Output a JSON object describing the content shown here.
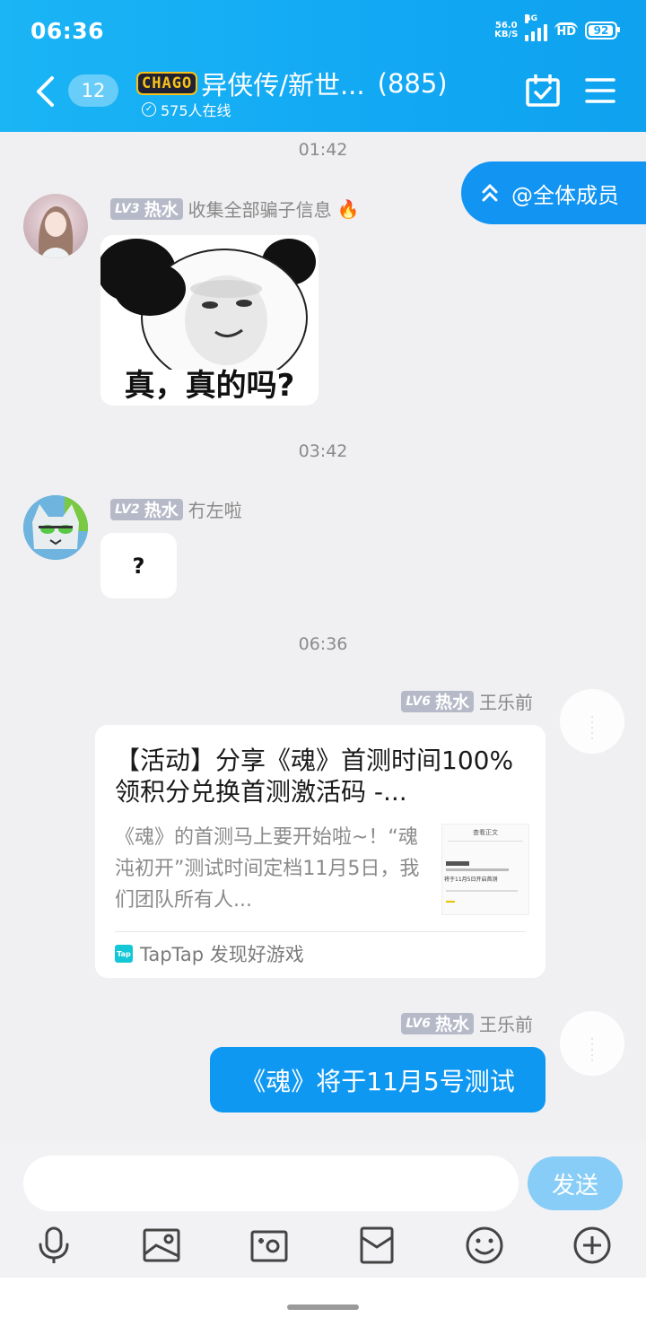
{
  "status_bar": {
    "time": "06:36",
    "net_speed_value": "56.0",
    "net_speed_unit": "KB/S",
    "network": "4G",
    "hd": "HD",
    "battery": "92"
  },
  "header": {
    "unread_count": "12",
    "logo_text": "CHAGO",
    "title": "异侠传/新世...",
    "member_count": "(885)",
    "online": "575人在线",
    "accent_color": "#12a8f3"
  },
  "at_all": {
    "label": "@全体成员"
  },
  "messages": [
    {
      "timestamp": "01:42",
      "level": "LV3",
      "tag": "热水",
      "sender": "收集全部骗子信息",
      "sender_emoji": "🔥",
      "sticker_caption": "真，真的吗?"
    },
    {
      "timestamp": "03:42",
      "level": "LV2",
      "tag": "热水",
      "sender": "冇左啦",
      "text": "?"
    },
    {
      "timestamp": "06:36",
      "level": "LV6",
      "tag": "热水",
      "sender": "王乐前",
      "card": {
        "title": "【活动】分享《魂》首测时间100%领积分兑换首测激活码 -...",
        "description": "《魂》的首测马上要开始啦~！“魂沌初开”测试时间定档11月5日，我们团队所有人...",
        "thumb_header": "查看正文",
        "thumb_line": "将于11月5日开启首测",
        "source_icon": "Tap",
        "source": "TapTap 发现好游戏"
      }
    },
    {
      "level": "LV6",
      "tag": "热水",
      "sender": "王乐前",
      "text": "《魂》将于11月5号测试"
    }
  ],
  "composer": {
    "input_value": "",
    "send_label": "发送"
  },
  "toolbar": {
    "icons": [
      "microphone-icon",
      "image-icon",
      "camera-icon",
      "red-packet-icon",
      "emoji-icon",
      "plus-icon"
    ]
  }
}
